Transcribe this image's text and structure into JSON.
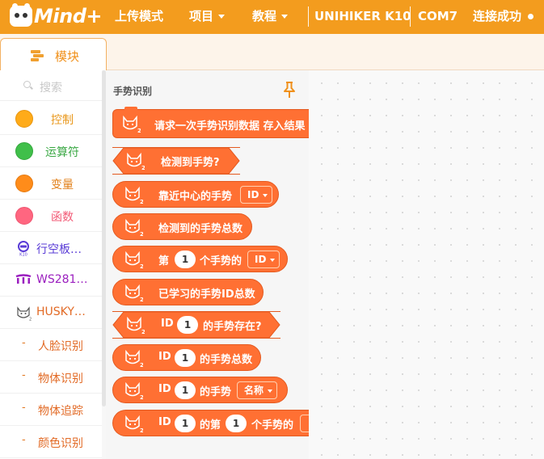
{
  "app": {
    "logo_text": "Mind+",
    "colors": {
      "brand": "#f39c1e",
      "block": "#ff7033",
      "control": "#ffab19",
      "operators": "#40bf4a",
      "variables": "#ff8c1a",
      "functions": "#ff6680"
    }
  },
  "topbar": {
    "upload_mode": "上传模式",
    "project": "项目",
    "tutorial": "教程",
    "device": "UNIHIKER K10",
    "port": "COM7",
    "status": "连接成功"
  },
  "tabs": {
    "modules": "模块"
  },
  "sidebar": {
    "search_placeholder": "搜索",
    "categories": [
      {
        "label": "控制",
        "color": "#ffab19"
      },
      {
        "label": "运算符",
        "color": "#40bf4a"
      },
      {
        "label": "变量",
        "color": "#ff8c1a"
      },
      {
        "label": "函数",
        "color": "#ff6680"
      },
      {
        "label": "行空板…",
        "icon": "k10-icon"
      },
      {
        "label": "WS281…",
        "icon": "led-strip-icon"
      },
      {
        "label": "HUSKY…",
        "icon": "huskylens-icon"
      },
      {
        "label": "人脸识别"
      },
      {
        "label": "物体识别"
      },
      {
        "label": "物体追踪"
      },
      {
        "label": "颜色识别"
      }
    ]
  },
  "flyout": {
    "title": "手势识别",
    "blocks": {
      "request": "请求一次手势识别数据 存入结果",
      "detected": "检测到手势?",
      "nearest_prefix": "靠近中心的手势",
      "nearest_dd": "ID",
      "total": "检测到的手势总数",
      "nth_prefix": "第",
      "nth_num": "1",
      "nth_mid": "个手势的",
      "nth_dd": "ID",
      "learned_total": "已学习的手势ID总数",
      "exists_prefix": "ID",
      "exists_num": "1",
      "exists_suffix": "的手势存在?",
      "count_prefix": "ID",
      "count_num": "1",
      "count_suffix": "的手势总数",
      "prop_prefix": "ID",
      "prop_num": "1",
      "prop_mid": "的手势",
      "prop_dd": "名称",
      "nthid_prefix": "ID",
      "nthid_num1": "1",
      "nthid_mid": "的第",
      "nthid_num2": "1",
      "nthid_suffix": "个手势的"
    }
  }
}
